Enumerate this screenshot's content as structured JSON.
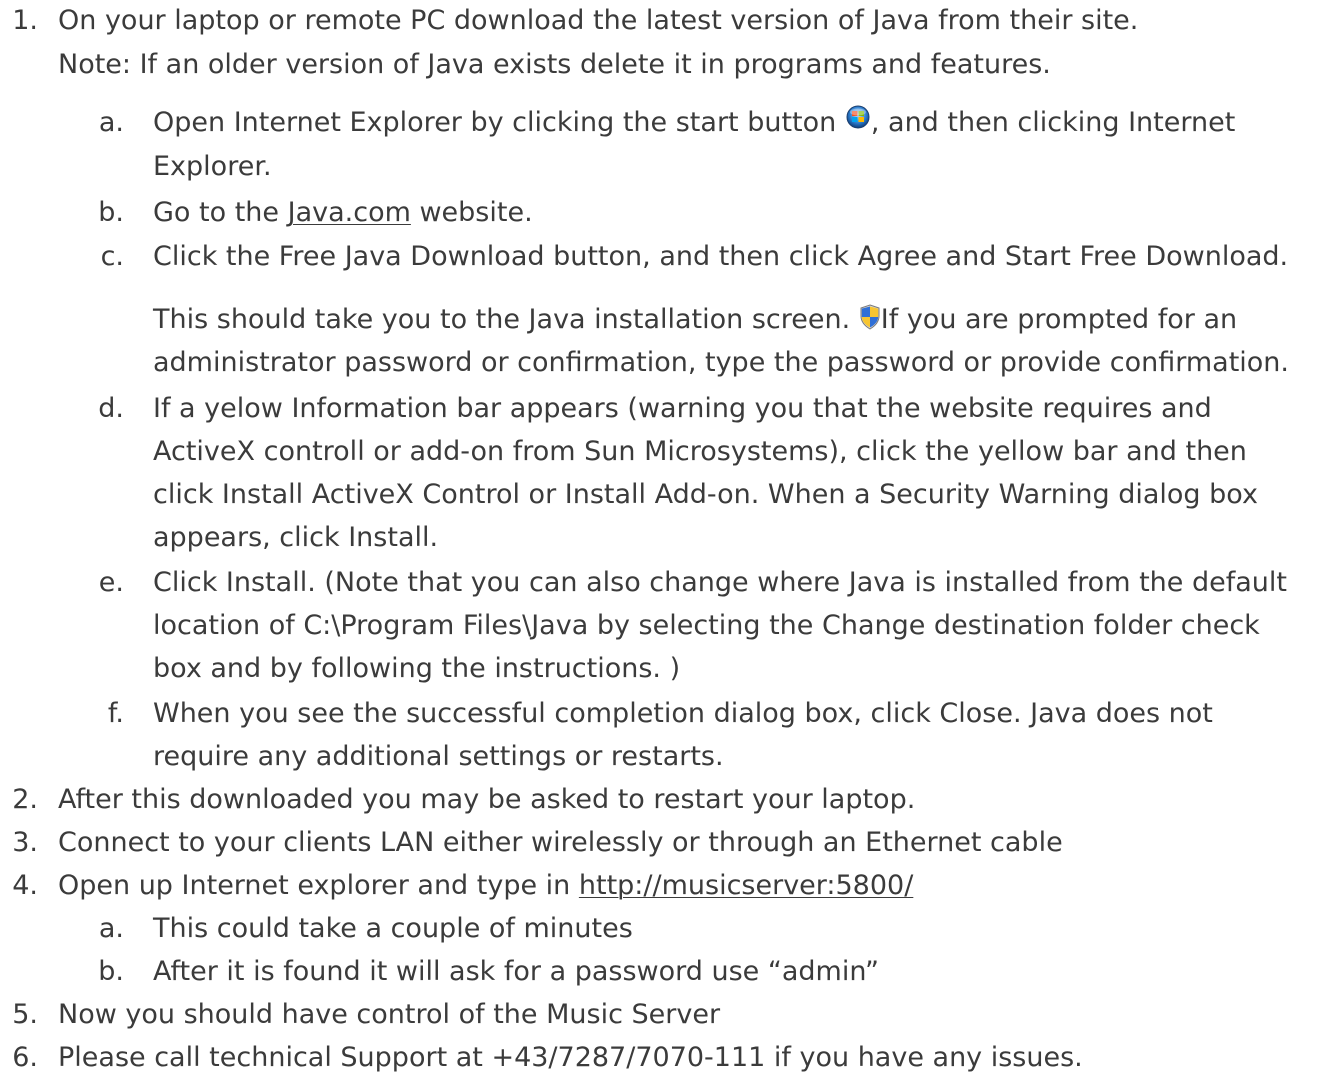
{
  "steps": [
    {
      "number": "1.",
      "line1": "On your laptop or remote PC download the latest version of Java from their site.",
      "line2": "Note: If an older version of Java exists delete it in programs and features.",
      "substeps": [
        {
          "letter": "a.",
          "part1": "Open Internet Explorer by clicking the start button ",
          "part2": ", and then clicking Internet",
          "line2": "Explorer."
        },
        {
          "letter": "b.",
          "before": "Go to the ",
          "link": "Java.com",
          "after": " website."
        },
        {
          "letter": "c.",
          "line1": "Click the Free Java Download button, and then click Agree and Start Free Download.",
          "line2a": "This should take you to the Java installation screen. ",
          "line2b": "If you are prompted for an",
          "line3": "administrator password or confirmation, type the password or provide confirmation."
        },
        {
          "letter": "d.",
          "lines": [
            "If a yelow Information bar appears (warning you that the website requires and",
            "ActiveX controll or add-on from Sun Microsystems), click the yellow bar and then",
            "click Install ActiveX Control or Install Add-on. When a Security Warning dialog box",
            "appears, click Install."
          ]
        },
        {
          "letter": "e.",
          "lines": [
            "Click Install. (Note that you can also change where Java is installed from the default",
            "location of C:\\Program Files\\Java by selecting the Change destination folder check",
            "box and by following the instructions. )"
          ]
        },
        {
          "letter": "f.",
          "lines": [
            "When you see the successful completion dialog box, click Close. Java does not",
            "require any additional settings or restarts."
          ]
        }
      ]
    },
    {
      "number": "2.",
      "text": "After this downloaded you may be asked to restart your laptop."
    },
    {
      "number": "3.",
      "text": "Connect to your clients LAN either wirelessly or through an Ethernet cable"
    },
    {
      "number": "4.",
      "before": "Open up Internet explorer and type in ",
      "link": "http://musicserver:5800/",
      "substeps": [
        {
          "letter": "a.",
          "text": "This could take a couple of minutes"
        },
        {
          "letter": "b.",
          "text": "After it is found it will ask for a password use “admin”"
        }
      ]
    },
    {
      "number": "5.",
      "text": "Now you should have control of the Music Server"
    },
    {
      "number": "6.",
      "text": "Please call technical Support at +43/7287/7070-111 if you have any issues."
    }
  ],
  "icons": {
    "start_button": "windows-start-orb-icon",
    "uac_shield": "uac-shield-icon"
  },
  "colors": {
    "text": "#3b3b3b",
    "background": "#ffffff"
  }
}
